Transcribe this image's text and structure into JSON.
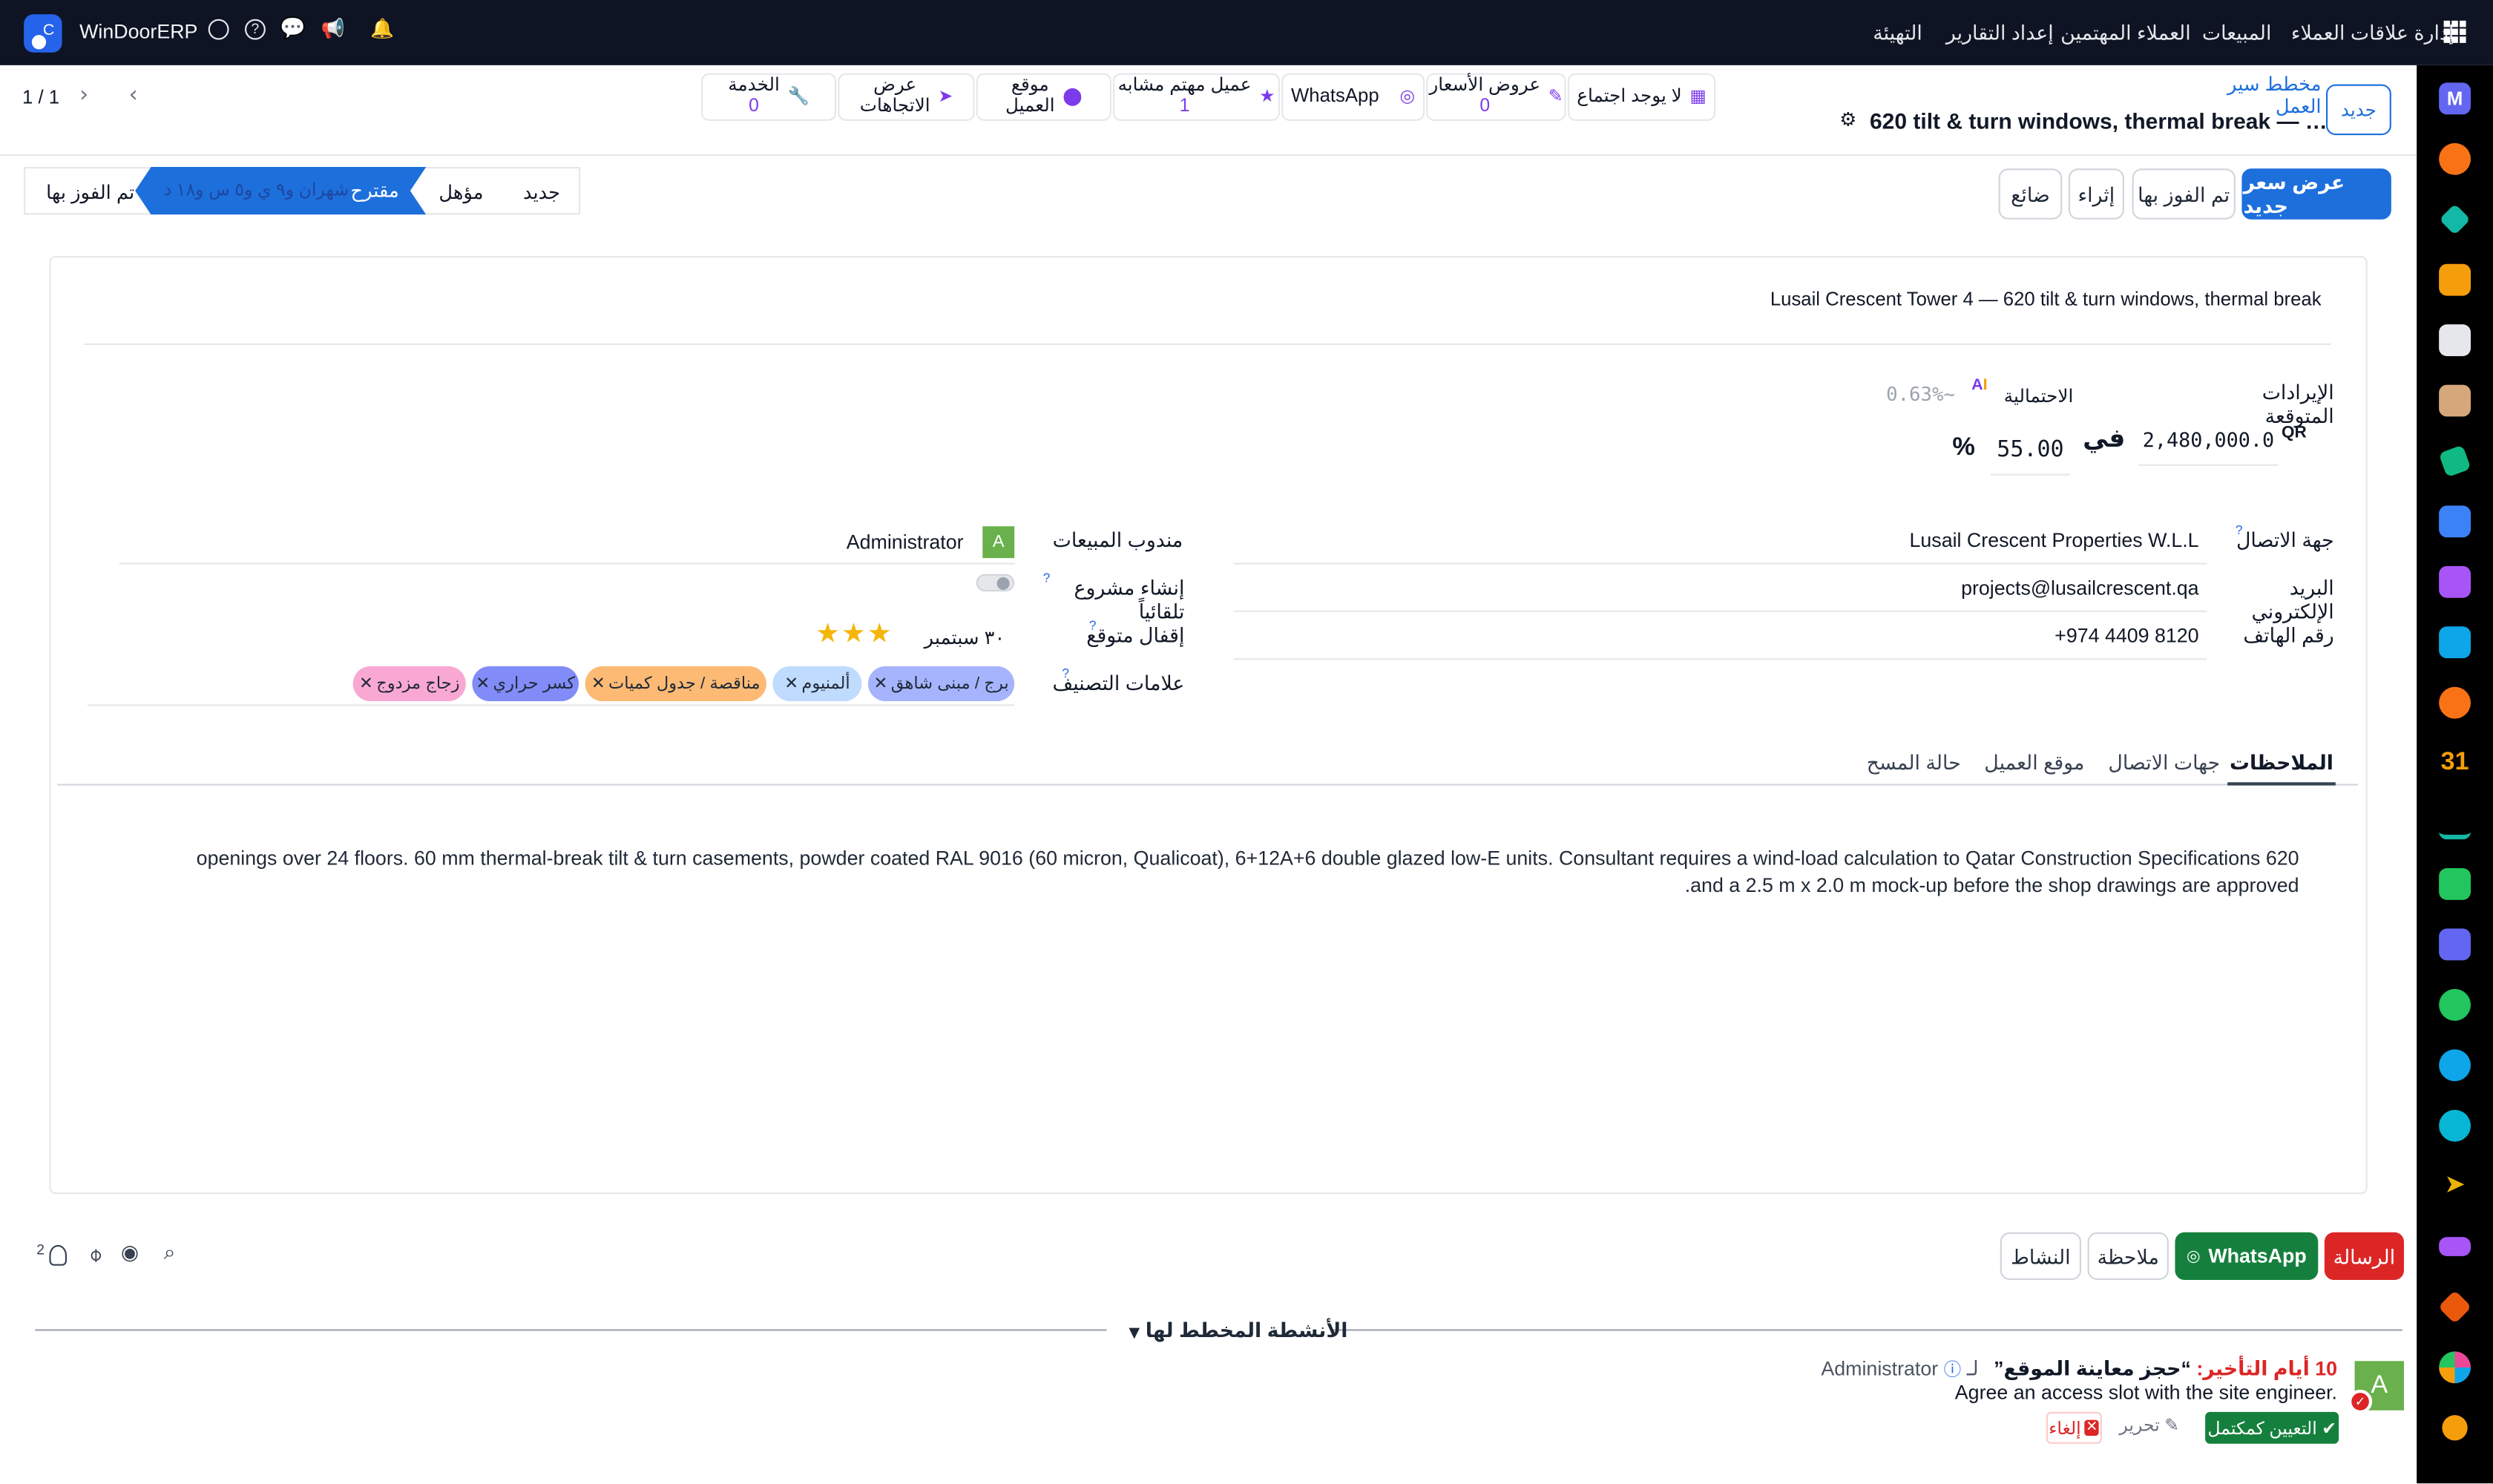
{
  "topbar": {
    "app_name": "WinDoorERP",
    "menus": [
      "إدارة علاقات العملاء",
      "المبيعات",
      "العملاء المهتمين",
      "إعداد التقارير",
      "التهيئة"
    ]
  },
  "control": {
    "new_label": "جديد",
    "breadcrumb": "مخطط سير العمل",
    "record_title": "620 tilt & turn windows, thermal break — …",
    "pager": "1 / 1"
  },
  "stats": {
    "meeting": "لا يوجد اجتماع",
    "quotes_label": "عروض الأسعار",
    "quotes_count": "0",
    "whatsapp": "WhatsApp",
    "similar_label": "عميل مهتم مشابه",
    "similar_count": "1",
    "location_l1": "موقع",
    "location_l2": "العميل",
    "directions_l1": "عرض",
    "directions_l2": "الاتجاهات",
    "service_label": "الخدمة",
    "service_count": "0"
  },
  "actions": {
    "new_quote": "عرض سعر جديد",
    "won": "تم الفوز بها",
    "enrich": "إثراء",
    "lost": "ضائع"
  },
  "stages": {
    "new": "جديد",
    "qualified": "مؤهل",
    "proposition": "مقترح",
    "proposition_hint": "شهران و٩ ي و٥ س و١٨ د",
    "won": "تم الفوز بها"
  },
  "form": {
    "name": "Lusail Crescent Tower 4 — 620 tilt & turn windows, thermal break",
    "expected_revenue_label": "الإيرادات المتوقعة",
    "currency": "QR",
    "revenue": "2,480,000.0",
    "at_label": "في",
    "probability": "55.00",
    "percent": "%",
    "probability_label": "الاحتمالية",
    "ai_probability": "~0.63%",
    "contact_label": "جهة الاتصال",
    "contact": "Lusail Crescent Properties W.L.L",
    "email_label": "البريد الإلكتروني",
    "email": "projects@lusailcrescent.qa",
    "phone_label": "رقم الهاتف",
    "phone": "+974 4409 8120",
    "salesperson_label": "مندوب المبيعات",
    "salesperson": "Administrator",
    "salesperson_initial": "A",
    "auto_project_label": "إنشاء مشروع تلقائياً",
    "expected_closing_label": "إقفال متوقع",
    "expected_closing": "٣٠ سبتمبر",
    "priority_stars": 3,
    "tags_label": "علامات التصنيف",
    "tags": [
      {
        "label": "برج / مبنى شاهق",
        "color": "#a5b4fc"
      },
      {
        "label": "ألمنيوم",
        "color": "#bfdbfe"
      },
      {
        "label": "مناقصة / جدول كميات",
        "color": "#fdba74"
      },
      {
        "label": "كسر حراري",
        "color": "#818cf8"
      },
      {
        "label": "زجاج مزدوج",
        "color": "#f9a8d4"
      }
    ]
  },
  "tabs": [
    "الملاحظات",
    "جهات الاتصال",
    "موقع العميل",
    "حالة المسح"
  ],
  "notes": {
    "line1": "620 openings over 24 floors. 60 mm thermal-break tilt & turn casements, powder coated RAL 9016 (60 micron, Qualicoat), 6+12A+6 double glazed low-E units. Consultant requires a wind-load calculation to Qatar Construction Specifications",
    "line2": "and a 2.5 m x 2.0 m mock-up before the shop drawings are approved."
  },
  "chatter": {
    "send_message": "الرسالة",
    "whatsapp": "WhatsApp",
    "log_note": "ملاحظة",
    "activity": "النشاط",
    "followers": "2",
    "planned_header": "الأنشطة المخطط لها",
    "delay": "10 أيام التأخير:",
    "activity_title": "“حجز معاينة الموقع”",
    "assignee": "Administrator",
    "assignee_prefix": "لـ",
    "activity_note": "Agree an access slot with the site engineer.",
    "mark_done": "التعيين كمكتمل",
    "edit": "تحرير",
    "cancel": "إلغاء",
    "avatar": "A"
  },
  "colors": {
    "primary": "#1d6fdc",
    "success": "#15803d",
    "danger": "#dc2626",
    "accent": "#7c3aed",
    "topbar": "#0f1424"
  }
}
